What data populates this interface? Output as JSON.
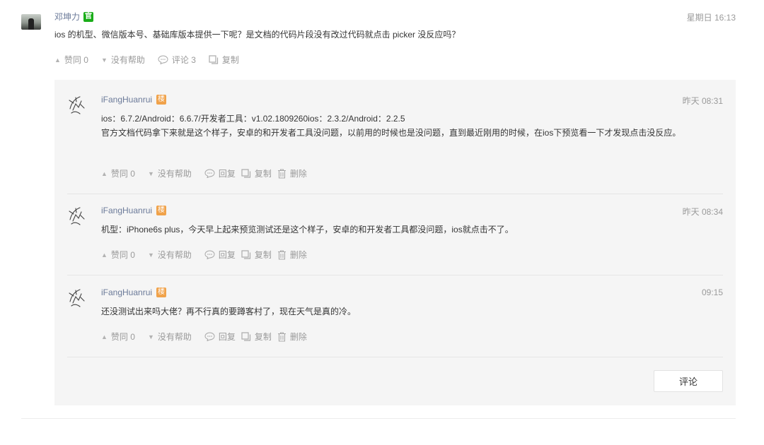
{
  "post": {
    "author": "邓坤力",
    "official_badge": "官",
    "time": "星期日 16:13",
    "content": "ios 的机型、微信版本号、基础库版本提供一下呢？是文档的代码片段没有改过代码就点击 picker 没反应吗？",
    "actions": {
      "upvote": "赞同 0",
      "downvote": "没有帮助",
      "comment": "评论 3",
      "copy": "复制"
    }
  },
  "replies": [
    {
      "author": "iFangHuanrui",
      "floor_badge": "楼",
      "time": "昨天 08:31",
      "line1": "ios：6.7.2/Android：6.6.7/开发者工具：v1.02.1809260ios：2.3.2/Android：2.2.5",
      "line2": "官方文档代码拿下来就是这个样子，安卓的和开发者工具没问题，以前用的时候也是没问题，直到最近刚用的时候，在ios下预览看一下才发现点击没反应。",
      "actions": {
        "upvote": "赞同 0",
        "downvote": "没有帮助",
        "reply": "回复",
        "copy": "复制",
        "delete": "删除"
      }
    },
    {
      "author": "iFangHuanrui",
      "floor_badge": "楼",
      "time": "昨天 08:34",
      "line1": "机型：iPhone6s plus，今天早上起来预览测试还是这个样子，安卓的和开发者工具都没问题，ios就点击不了。",
      "actions": {
        "upvote": "赞同 0",
        "downvote": "没有帮助",
        "reply": "回复",
        "copy": "复制",
        "delete": "删除"
      }
    },
    {
      "author": "iFangHuanrui",
      "floor_badge": "楼",
      "time": "09:15",
      "line1": "还没测试出来吗大佬？再不行真的要蹲客村了，现在天气是真的冷。",
      "actions": {
        "upvote": "赞同 0",
        "downvote": "没有帮助",
        "reply": "回复",
        "copy": "复制",
        "delete": "删除"
      }
    }
  ],
  "comment_button": "评论",
  "colors": {
    "link": "#6b7a99",
    "official": "#1aad19",
    "floor": "#f0a24a",
    "muted": "#9a9a9a",
    "panel": "#f5f5f5"
  }
}
